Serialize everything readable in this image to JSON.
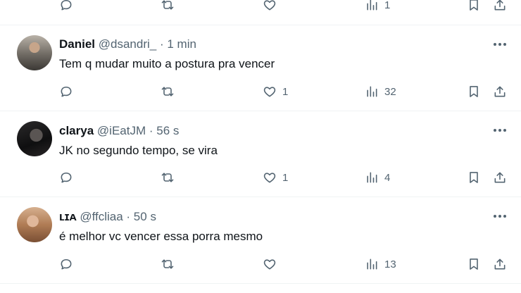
{
  "top_row": {
    "views": "1"
  },
  "tweets": [
    {
      "name": "Daniel",
      "handle": "@dsandri_",
      "time": "· 1 min",
      "text": "Tem q mudar muito a postura pra vencer",
      "likes": "1",
      "views": "32"
    },
    {
      "name": "clarya",
      "handle": "@iEatJM",
      "time": "· 56 s",
      "text": "JK no segundo tempo, se vira",
      "likes": "1",
      "views": "4"
    },
    {
      "name": "ʟɪᴀ",
      "handle": "@ffcliaa",
      "time": "· 50 s",
      "text": "é melhor vc vencer essa porra mesmo",
      "likes": "",
      "views": "13"
    }
  ],
  "icons": {
    "reply": "reply-icon",
    "retweet": "retweet-icon",
    "like": "heart-icon",
    "views": "views-chart-icon",
    "bookmark": "bookmark-icon",
    "share": "share-icon",
    "more": "more-dots-icon"
  },
  "colors": {
    "text": "#0f1419",
    "secondary": "#536471",
    "divider": "#eff3f4"
  }
}
